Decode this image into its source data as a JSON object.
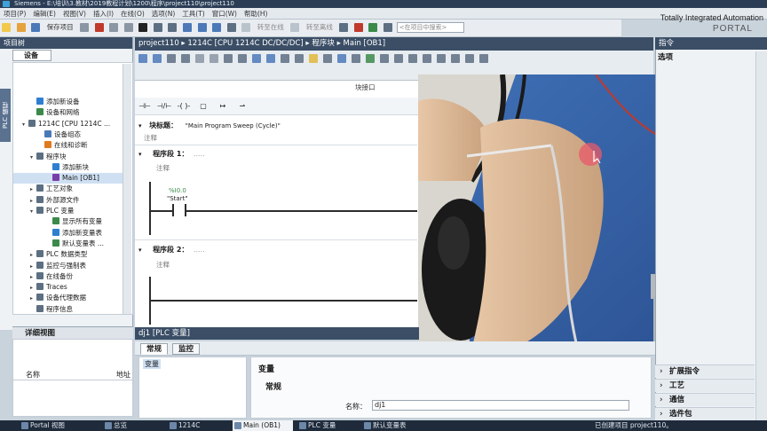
{
  "window": {
    "title": "Siemens - E:\\培训\\3.教材\\2019教程计划\\1200\\程序\\project110\\project110"
  },
  "menu": [
    "项目(P)",
    "编辑(E)",
    "视图(V)",
    "插入(I)",
    "在线(O)",
    "选项(N)",
    "工具(T)",
    "窗口(W)",
    "帮助(H)"
  ],
  "brand": {
    "line1": "Totally Integrated Automation",
    "line2": "PORTAL"
  },
  "toolbar": {
    "save_label": "保存项目",
    "go_online": "转至在线",
    "go_offline": "转至离线",
    "search_placeholder": "<在项目中搜索>"
  },
  "project_tree": {
    "title": "项目树",
    "side_tab": "PLC 编程",
    "device_tab": "设备",
    "items": [
      {
        "label": "添加新设备",
        "indent": 1,
        "arrow": "",
        "icon_color": "#2f7fd1"
      },
      {
        "label": "设备和网络",
        "indent": 1,
        "arrow": "",
        "icon_color": "#3b8a4a"
      },
      {
        "label": "1214C [CPU 1214C ...",
        "indent": 0,
        "arrow": "▾",
        "icon_color": "#5d6f82"
      },
      {
        "label": "设备组态",
        "indent": 2,
        "arrow": "",
        "icon_color": "#4b79b8"
      },
      {
        "label": "在线和诊断",
        "indent": 2,
        "arrow": "",
        "icon_color": "#e07a1f"
      },
      {
        "label": "程序块",
        "indent": 1,
        "arrow": "▾",
        "icon_color": "#5d6f82"
      },
      {
        "label": "添加新块",
        "indent": 3,
        "arrow": "",
        "icon_color": "#2f7fd1"
      },
      {
        "label": "Main [OB1]",
        "indent": 3,
        "arrow": "",
        "icon_color": "#7a3da8",
        "selected": true
      },
      {
        "label": "工艺对象",
        "indent": 1,
        "arrow": "▸",
        "icon_color": "#5d6f82"
      },
      {
        "label": "外部源文件",
        "indent": 1,
        "arrow": "▸",
        "icon_color": "#5d6f82"
      },
      {
        "label": "PLC 变量",
        "indent": 1,
        "arrow": "▾",
        "icon_color": "#5d6f82"
      },
      {
        "label": "显示所有变量",
        "indent": 3,
        "arrow": "",
        "icon_color": "#3b8a4a"
      },
      {
        "label": "添加新变量表",
        "indent": 3,
        "arrow": "",
        "icon_color": "#2f7fd1"
      },
      {
        "label": "默认变量表 ...",
        "indent": 3,
        "arrow": "",
        "icon_color": "#3b8a4a"
      },
      {
        "label": "PLC 数据类型",
        "indent": 1,
        "arrow": "▸",
        "icon_color": "#5d6f82"
      },
      {
        "label": "监控与强制表",
        "indent": 1,
        "arrow": "▸",
        "icon_color": "#5d6f82"
      },
      {
        "label": "在线备份",
        "indent": 1,
        "arrow": "▸",
        "icon_color": "#5d6f82"
      },
      {
        "label": "Traces",
        "indent": 1,
        "arrow": "▸",
        "icon_color": "#5d6f82"
      },
      {
        "label": "设备代理数据",
        "indent": 1,
        "arrow": "▸",
        "icon_color": "#5d6f82"
      },
      {
        "label": "程序信息",
        "indent": 1,
        "arrow": "",
        "icon_color": "#5d6f82"
      }
    ]
  },
  "detail_view": {
    "title": "详细视图",
    "col_name": "名称",
    "col_addr": "地址"
  },
  "editor": {
    "breadcrumb": "project110 ▸ 1214C [CPU 1214C DC/DC/DC] ▸ 程序块 ▸ Main [OB1]",
    "block_interface": "块接口",
    "block_title_label": "块标题：",
    "block_title_value": "\"Main Program Sweep (Cycle)\"",
    "comment": "注释",
    "network1": "程序段 1：",
    "network2": "程序段 2：",
    "net_ellipsis": ".....",
    "contact_address": "%I0.0",
    "contact_tag": "\"Start\""
  },
  "properties": {
    "title": "dj1 [PLC 变量]",
    "tab_general": "常规",
    "tab_monitor": "监控",
    "left_item": "变量",
    "section": "变量",
    "subsection": "常规",
    "name_label": "名称：",
    "name_value": "dj1"
  },
  "instructions": {
    "title": "指令",
    "options": "选项",
    "sections": [
      "扩展指令",
      "工艺",
      "通信",
      "选件包"
    ]
  },
  "taskbar": {
    "portal": "Portal 视图",
    "tasks": [
      "总览",
      "1214C",
      "Main (OB1)",
      "PLC 变量",
      "默认变量表"
    ],
    "status": "已创建项目 project110。"
  },
  "colors": {
    "accent": "#3b4e66",
    "selection": "#cfe0f3"
  }
}
